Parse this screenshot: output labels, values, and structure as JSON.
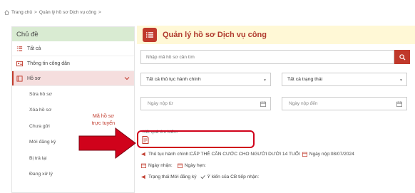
{
  "breadcrumb": {
    "home": "Trang chủ",
    "separator1": ">",
    "current": "Quản lý hồ sơ Dịch vụ công",
    "separator2": ">"
  },
  "sidebar": {
    "title": "Chủ đề",
    "items": [
      {
        "label": "Tất cả",
        "icon": "list-icon"
      },
      {
        "label": "Thông tin công dân",
        "icon": "id-card-icon"
      },
      {
        "label": "Hồ sơ",
        "icon": "folder-icon",
        "active": true
      }
    ],
    "subitems": [
      "Sửa hồ sơ",
      "Xóa hồ sơ",
      "Chưa gửi",
      "Mới đăng ký",
      "Bị trả lại",
      "Đang xử lý"
    ]
  },
  "main": {
    "title": "Quản lý hồ sơ Dịch vụ công",
    "search": {
      "placeholder": "Nhập mã hồ sơ cần tìm"
    },
    "filters": {
      "procedure": "Tất cả thủ tục hành chính",
      "status": "Tất cả trạng thái"
    },
    "dates": {
      "from_placeholder": "Ngày nộp từ",
      "to_placeholder": "Ngày nộp đến"
    },
    "results_label": "Kết quả tìm kiếm",
    "result": {
      "procedure_label": "Thủ tục hành chính:",
      "procedure_value": "CẤP THẺ CĂN CƯỚC CHO NGƯỜI DƯỚI 14 TUỔI",
      "submit_label": "Ngày nộp:",
      "submit_value": "08/07/2024",
      "receive_label": "Ngày nhận:",
      "due_label": "Ngày hẹn:",
      "status_label": "Trạng thái:",
      "status_value": "Mới đăng ký",
      "opinion_label": "Ý kiến của CB tiếp nhận:"
    }
  },
  "annotation": {
    "line1": "Mã hồ sơ",
    "line2": "trực tuyến",
    "color": "#d0021b"
  },
  "colors": {
    "accent": "#c0392b",
    "sidebar_header": "#d9ebd2",
    "main_header": "#fff8d6",
    "active_item": "#f5dede"
  }
}
